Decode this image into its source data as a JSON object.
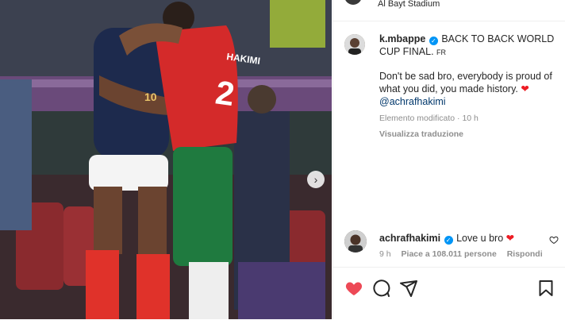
{
  "post": {
    "location": "Al Bayt Stadium",
    "image_alt": "Two football players embracing on the pitch",
    "player_name": "HAKIMI",
    "player_number": "2",
    "france_number": "10"
  },
  "caption": {
    "username": "k.mbappe",
    "verified_mark": "✓",
    "title": "BACK TO BACK WORLD CUP FINAL.",
    "lang": "FR",
    "body": "Don't be sad bro, everybody is proud of what you did, you made history.",
    "heart": "❤",
    "mention": "@achrafhakimi",
    "edited": "Elemento modificato · 10 h",
    "translate": "Visualizza traduzione"
  },
  "comment": {
    "username": "achrafhakimi",
    "verified_mark": "✓",
    "text": "Love u bro",
    "heart": "❤",
    "time": "9 h",
    "likes": "Piace a 108.011 persone",
    "reply": "Rispondi"
  },
  "colors": {
    "like_red": "#ed4956",
    "verified_blue": "#0095f6",
    "morocco_red": "#d42a2a",
    "morocco_green": "#1f7a3f",
    "france_blue": "#1d2a4d"
  },
  "icons": {
    "next": "›",
    "like": "heart-filled-icon",
    "comment": "comment-icon",
    "share": "share-icon",
    "save": "bookmark-icon"
  }
}
